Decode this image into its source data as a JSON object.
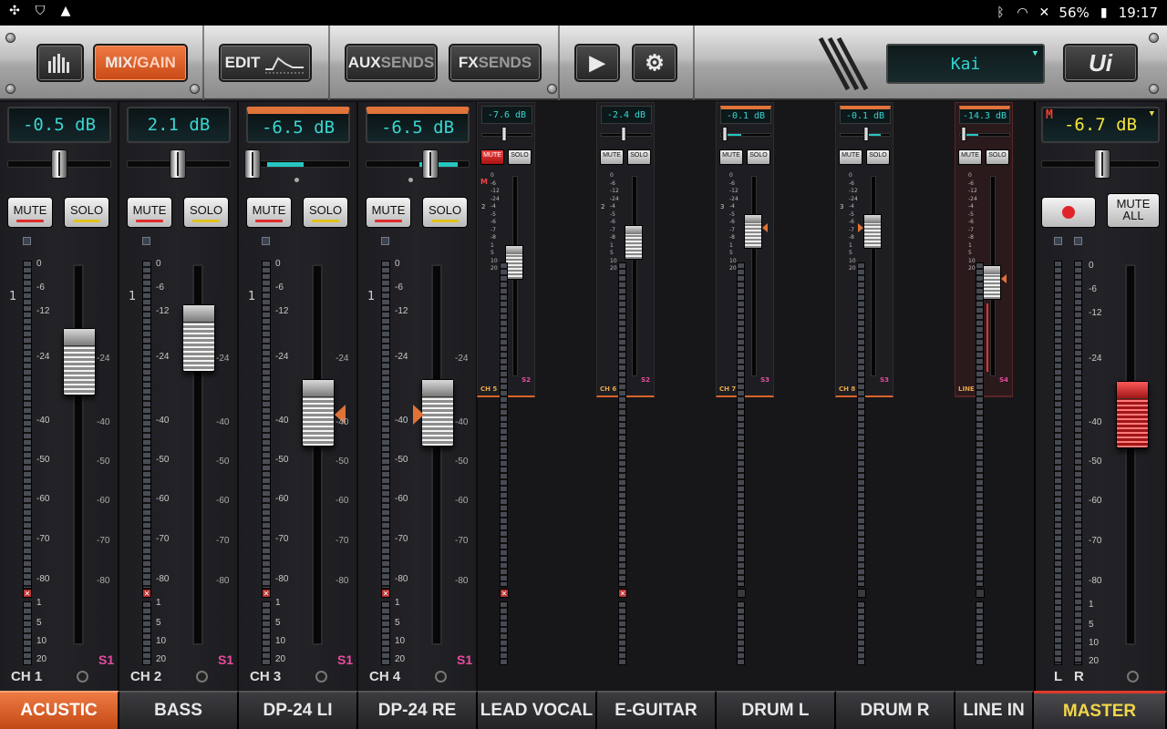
{
  "status_bar": {
    "battery": "56%",
    "time": "19:17"
  },
  "toolbar": {
    "mix_label": "MIX",
    "gain_label": "/GAIN",
    "edit_label": "EDIT",
    "aux_label": "AUX",
    "aux_sends_label": "SENDS",
    "fx_label": "FX",
    "fx_sends_label": "SENDS",
    "show_name": "Kai",
    "logo": "Ui"
  },
  "strips": [
    {
      "db": "-0.5 dB",
      "mute": "MUTE",
      "solo": "SOLO",
      "channel": "CH 1",
      "group": "1",
      "subgroup": "S1",
      "fader_db": "-24"
    },
    {
      "db": "2.1 dB",
      "mute": "MUTE",
      "solo": "SOLO",
      "channel": "CH 2",
      "group": "1",
      "subgroup": "S1",
      "fader_db": "-24"
    },
    {
      "db": "-6.5 dB",
      "mute": "MUTE",
      "solo": "SOLO",
      "channel": "CH 3",
      "group": "1",
      "subgroup": "S1",
      "fader_db": "-40"
    },
    {
      "db": "-6.5 dB",
      "mute": "MUTE",
      "solo": "SOLO",
      "channel": "CH 4",
      "group": "1",
      "subgroup": "S1",
      "fader_db": "-40"
    }
  ],
  "mini_strips": [
    {
      "db": "-7.6 dB",
      "mute": "MUTE",
      "solo": "SOLO",
      "channel": "CH 5",
      "group": "2",
      "subgroup": "S2",
      "mark": "M"
    },
    {
      "db": "-2.4 dB",
      "mute": "MUTE",
      "solo": "SOLO",
      "channel": "CH 6",
      "group": "2",
      "subgroup": "S2"
    },
    {
      "db": "-0.1 dB",
      "mute": "MUTE",
      "solo": "SOLO",
      "channel": "CH 7",
      "group": "3",
      "subgroup": "S3"
    },
    {
      "db": "-0.1 dB",
      "mute": "MUTE",
      "solo": "SOLO",
      "channel": "CH 8",
      "group": "3",
      "subgroup": "S3"
    },
    {
      "db": "-14.3 dB",
      "mute": "MUTE",
      "solo": "SOLO",
      "channel": "LINE",
      "group": "",
      "subgroup": "S4"
    }
  ],
  "master": {
    "db": "-6.7 dB",
    "mark": "M",
    "mute_all_line1": "MUTE",
    "mute_all_line2": "ALL",
    "left": "L",
    "right": "R"
  },
  "scale_labels": [
    "0",
    "-6",
    "-12",
    "-24",
    "-40",
    "-50",
    "-60",
    "-70",
    "-80",
    "1",
    "5",
    "10",
    "20"
  ],
  "fader_scale": [
    "-24",
    "-40",
    "-50",
    "-60",
    "-70",
    "-80"
  ],
  "mini_scale": [
    "0",
    "-6",
    "-12",
    "-24",
    "-4",
    "-5",
    "-6",
    "-7",
    "-8",
    "1",
    "5",
    "10",
    "20"
  ],
  "tabs": [
    "ACUSTIC",
    "BASS",
    "DP-24  LI",
    "DP-24 RE",
    "LEAD VOCAL",
    "E-GUITAR",
    "DRUM L",
    "DRUM R",
    "LINE IN",
    "MASTER"
  ],
  "colors": {
    "accent": "#e0733a",
    "display": "#39d6d0",
    "master_display": "#f2e53a",
    "mute": "#e02a2a",
    "solo": "#e2c31a"
  }
}
